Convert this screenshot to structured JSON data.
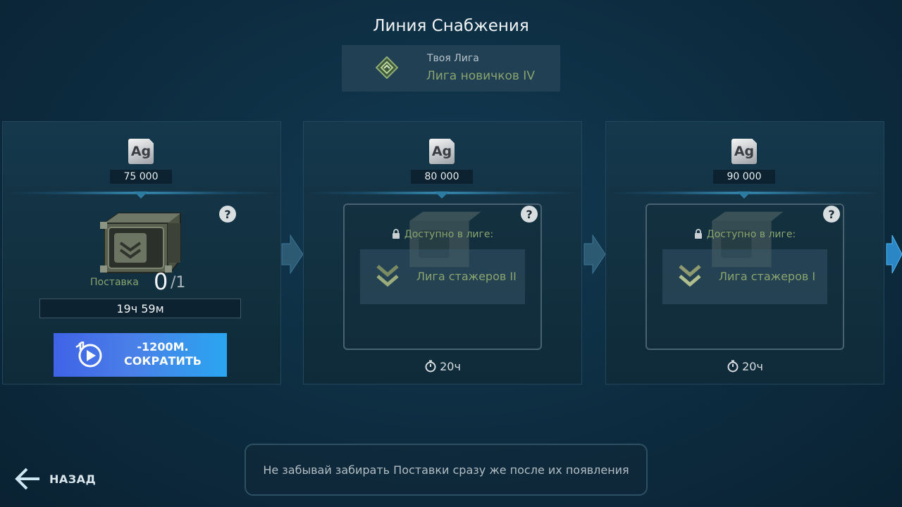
{
  "header": {
    "title": "Линия Снабжения",
    "league_caption": "Твоя Лига",
    "league_name": "Лига новичков IV"
  },
  "cards": [
    {
      "currency": "Ag",
      "amount": "75 000",
      "help": "?",
      "supply_label": "Поставка",
      "supply_count": "0",
      "supply_total": "/1",
      "timer": "19ч 59м",
      "speedup_cost": "-1200М.",
      "speedup_label": "СОКРАТИТЬ"
    },
    {
      "currency": "Ag",
      "amount": "80 000",
      "help": "?",
      "locked_caption": "Доступно в лиге:",
      "required_league": "Лига стажеров II",
      "duration": "20ч"
    },
    {
      "currency": "Ag",
      "amount": "90 000",
      "help": "?",
      "locked_caption": "Доступно в лиге:",
      "required_league": "Лига стажеров I",
      "duration": "20ч"
    }
  ],
  "footer": {
    "back_label": "НАЗАД",
    "hint": "Не забывай забирать Поставки сразу же после их появления"
  },
  "colors": {
    "accent_green": "#8aa46f",
    "button_gradient_start": "#3f63e7",
    "button_gradient_end": "#2aa6f0",
    "background": "#0d2c40"
  },
  "icons": [
    "league-diamond-icon",
    "silver-ag-icon",
    "help-icon",
    "supply-chest-icon",
    "speedup-video-icon",
    "lock-icon",
    "rank-chevron-icon",
    "stopwatch-icon",
    "next-arrow-icon",
    "back-arrow-icon"
  ]
}
